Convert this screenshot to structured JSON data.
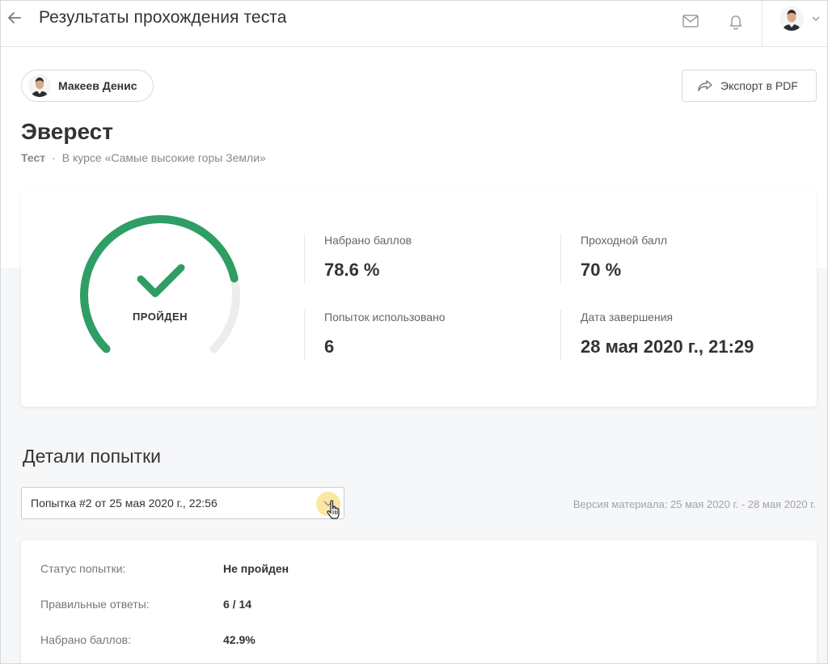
{
  "header": {
    "title": "Результаты прохождения теста",
    "icons": [
      "back-arrow-icon",
      "mail-icon",
      "bell-icon",
      "chevron-down-icon"
    ]
  },
  "user": {
    "name": "Макеев Денис"
  },
  "export": {
    "label": "Экспорт в PDF"
  },
  "test": {
    "title": "Эверест",
    "type": "Тест",
    "separator": "·",
    "course": "В курсе «Самые высокие горы Земли»"
  },
  "result": {
    "status": "ПРОЙДЕН",
    "gauge_fraction": 0.786,
    "pass_fraction": 0.7,
    "colors": {
      "pass": "#2e9e64",
      "track": "#ededed"
    },
    "stats": {
      "score_label": "Набрано баллов",
      "score_value": "78.6 %",
      "pass_label": "Проходной балл",
      "pass_value": "70 %",
      "attempts_label": "Попыток использовано",
      "attempts_value": "6",
      "date_label": "Дата завершения",
      "date_value": "28 мая 2020 г., 21:29"
    }
  },
  "details": {
    "title": "Детали попытки",
    "attempt_selected": "Попытка #2 от 25 мая 2020 г., 22:56",
    "version": "Версия материала: 25 мая 2020 г. - 28 мая 2020 г.",
    "rows": [
      {
        "label": "Статус попытки:",
        "value": "Не пройден"
      },
      {
        "label": "Правильные ответы:",
        "value": "6 / 14"
      },
      {
        "label": "Набрано баллов:",
        "value": "42.9%"
      }
    ]
  }
}
